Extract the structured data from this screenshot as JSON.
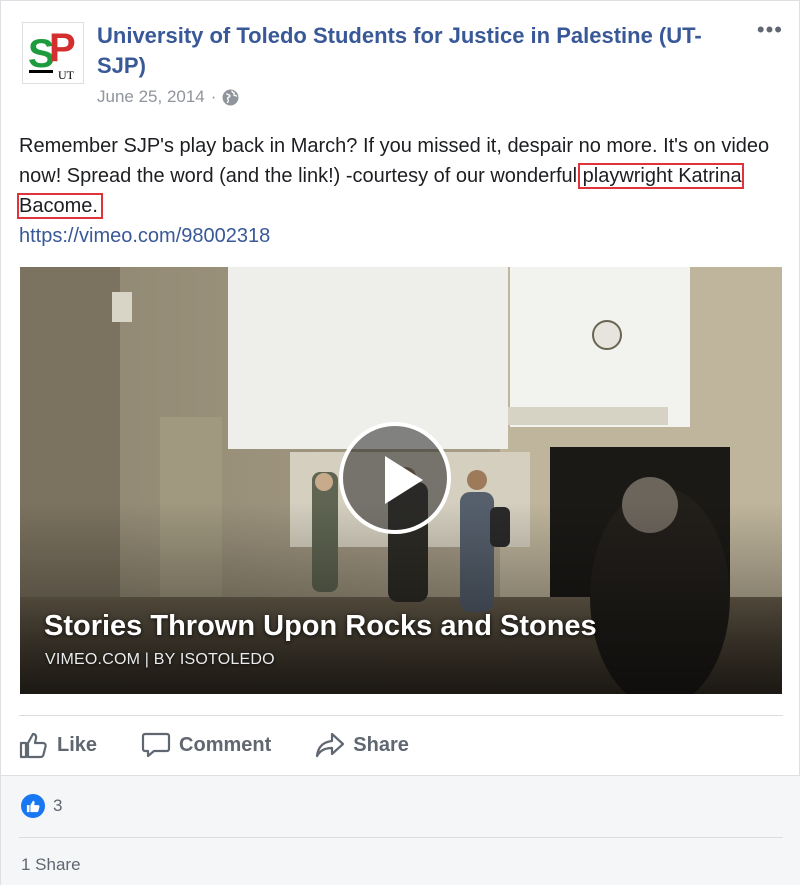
{
  "post": {
    "page_name": "University of Toledo Students for Justice in Palestine (UT-SJP)",
    "avatar_letters": {
      "s": "S",
      "p": "P",
      "ut": "UT"
    },
    "date": "June 25, 2014",
    "separator": "·",
    "privacy_icon": "globe-icon",
    "more_icon": "•••",
    "text_part1": "Remember SJP's play back in March? If you missed it, despair no more. It's on video now! Spread the word (and the link!) -courtesy of our wonderful ",
    "text_highlight": "playwright Katrina Bacome.",
    "link": "https://vimeo.com/98002318"
  },
  "video": {
    "title": "Stories Thrown Upon Rocks and Stones",
    "source": "VIMEO.COM | BY ISOTOLEDO",
    "play_icon": "play-icon"
  },
  "actions": {
    "like_label": "Like",
    "comment_label": "Comment",
    "share_label": "Share"
  },
  "footer": {
    "reaction_count": "3",
    "share_count": "1 Share"
  },
  "colors": {
    "link": "#385898",
    "muted": "#606770",
    "highlight_border": "#e0333b",
    "like_blue": "#1877f2",
    "avatar_green": "#1e9b3c",
    "avatar_red": "#d32f2f"
  }
}
